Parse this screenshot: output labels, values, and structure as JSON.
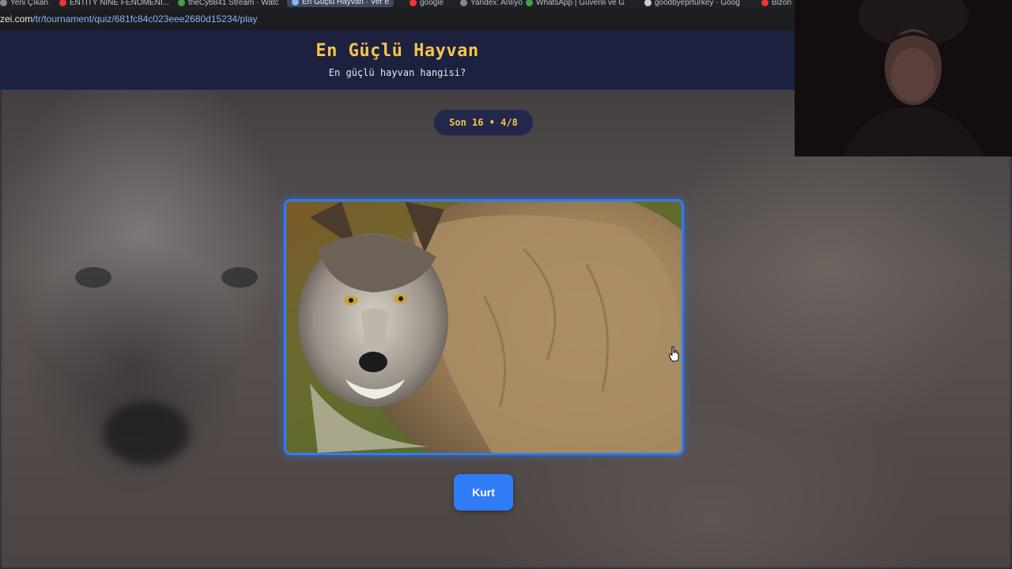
{
  "browser": {
    "tabs": [
      {
        "label": "Yeni Çıkan",
        "color": "#888888"
      },
      {
        "label": "ENTITY NİNE FENOMENİ...",
        "color": "#e53935"
      },
      {
        "label": "theCyb841 Stream · Watc",
        "color": "#43a047"
      },
      {
        "label": "En Güçlü Hayvan · Ver e",
        "color": "#8ab4f8",
        "active": true
      },
      {
        "label": "google",
        "color": "#e53935"
      },
      {
        "label": "Yandex: Anlıyo",
        "color": "#888888"
      },
      {
        "label": "WhatsApp | Güvenli ve G",
        "color": "#43a047"
      },
      {
        "label": "goodbyeprtürkey · Goog",
        "color": "#cccccc"
      },
      {
        "label": "Bizon",
        "color": "#e53935"
      }
    ],
    "url_host": "zei.com",
    "url_path": "/tr/tournament/quiz/681fc84c023eee2680d15234/play"
  },
  "header": {
    "title": "En Güçlü Hayvan",
    "subtitle": "En güçlü hayvan hangisi?"
  },
  "round": {
    "label": "Son 16 • 4/8"
  },
  "choice": {
    "image_icon": "wolf-photo",
    "label": "Kurt",
    "accent": "#2f7cf6"
  },
  "colors": {
    "header_bg": "#1d2140",
    "title": "#f6c54a",
    "pill_text": "#f2c248"
  }
}
